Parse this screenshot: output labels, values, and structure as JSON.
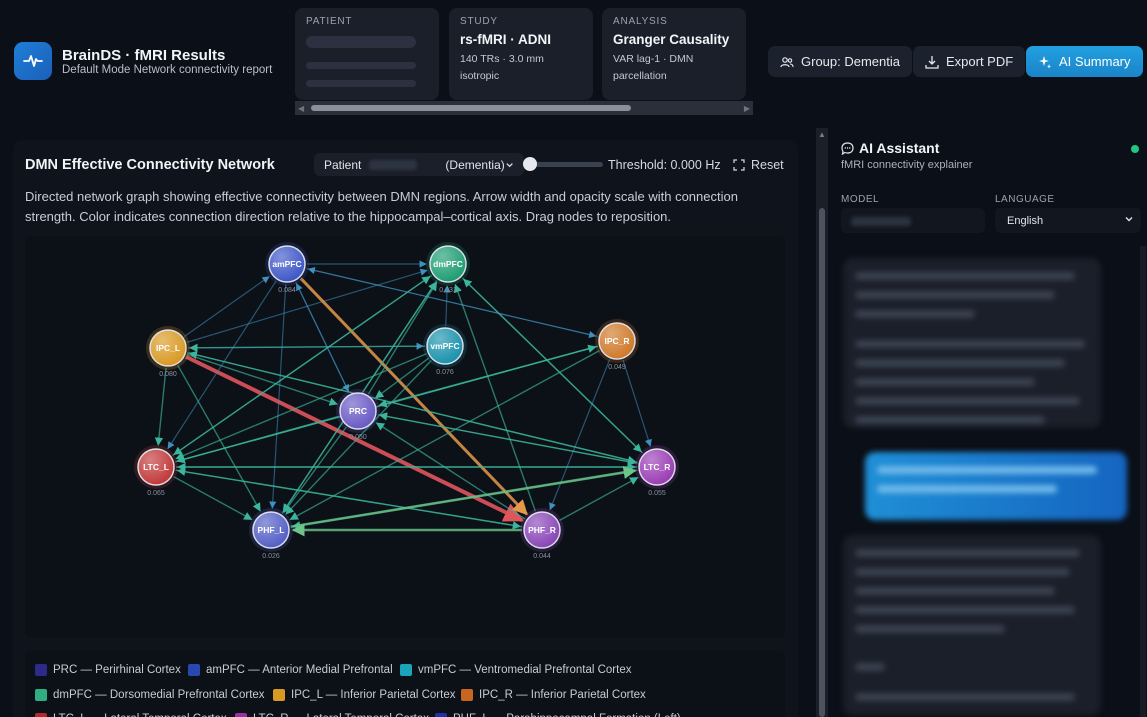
{
  "app": {
    "title": "BrainDS · fMRI Results",
    "subtitle": "Default Mode Network connectivity report",
    "logo_icon": "pulse-icon"
  },
  "cards": {
    "patient": {
      "label": "PATIENT"
    },
    "study": {
      "label": "STUDY",
      "title": "rs-fMRI · ADNI",
      "desc_1": "140 TRs · 3.0 mm",
      "desc_2": "isotropic"
    },
    "analysis": {
      "label": "ANALYSIS",
      "title": "Granger Causality",
      "desc_1": "VAR lag-1 · DMN",
      "desc_2": "parcellation"
    }
  },
  "header_buttons": {
    "group": {
      "label": "Group: Dementia",
      "icon": "users-icon"
    },
    "export": {
      "label": "Export PDF",
      "icon": "download-icon"
    },
    "ai": {
      "label": "AI Summary",
      "icon": "sparkle-icon"
    }
  },
  "network_panel": {
    "title": "DMN Effective Connectivity Network",
    "patient_select": {
      "prefix": "Patient",
      "group": "(Dementia)"
    },
    "threshold": {
      "label": "Threshold:",
      "value": "0.000",
      "unit": "Hz",
      "level": 0
    },
    "reset_label": "Reset",
    "description": "Directed network graph showing effective connectivity between DMN regions. Arrow width and opacity scale with connection strength. Color indicates connection direction relative to the hippocampal–cortical axis. Drag nodes to reposition."
  },
  "nodes": [
    {
      "id": "amPFC",
      "value": "0.084",
      "color": "#3f58c8"
    },
    {
      "id": "dmPFC",
      "value": "0.031",
      "color": "#1f9e73"
    },
    {
      "id": "IPC_L",
      "value": "0.080",
      "color": "#d99a24"
    },
    {
      "id": "vmPFC",
      "value": "0.076",
      "color": "#1b93ad"
    },
    {
      "id": "IPC_R",
      "value": "0.049",
      "color": "#d07a2a"
    },
    {
      "id": "PRC",
      "value": "0.050",
      "color": "#6a5bc4"
    },
    {
      "id": "LTC_L",
      "value": "0.065",
      "color": "#c23a3a"
    },
    {
      "id": "LTC_R",
      "value": "0.055",
      "color": "#9b3eb5"
    },
    {
      "id": "PHF_L",
      "value": "0.026",
      "color": "#5560c6"
    },
    {
      "id": "PHF_R",
      "value": "0.044",
      "color": "#8a47b8"
    }
  ],
  "legend": [
    {
      "label": "PRC — Perirhinal Cortex",
      "color": "#2d2a8a"
    },
    {
      "label": "amPFC — Anterior Medial Prefrontal",
      "color": "#2848b0"
    },
    {
      "label": "vmPFC — Ventromedial Prefrontal Cortex",
      "color": "#1aa5b8"
    },
    {
      "label": "dmPFC — Dorsomedial Prefrontal Cortex",
      "color": "#2fae82"
    },
    {
      "label": "IPC_L — Inferior Parietal Cortex",
      "color": "#d99a24"
    },
    {
      "label": "IPC_R — Inferior Parietal Cortex",
      "color": "#c8661f"
    },
    {
      "label": "LTC_L — Lateral Temporal Cortex",
      "color": "#b42a2a"
    },
    {
      "label": "LTC_R — Lateral Temporal Cortex",
      "color": "#9a2fa8"
    },
    {
      "label": "PHF_L — Parahippocampal Formation (Left)",
      "color": "#2030a8"
    }
  ],
  "ai_panel": {
    "title": "AI Assistant",
    "title_icon": "chat-icon",
    "subtitle": "fMRI connectivity explainer",
    "model_label": "MODEL",
    "language_label": "LANGUAGE",
    "language_value": "English"
  }
}
